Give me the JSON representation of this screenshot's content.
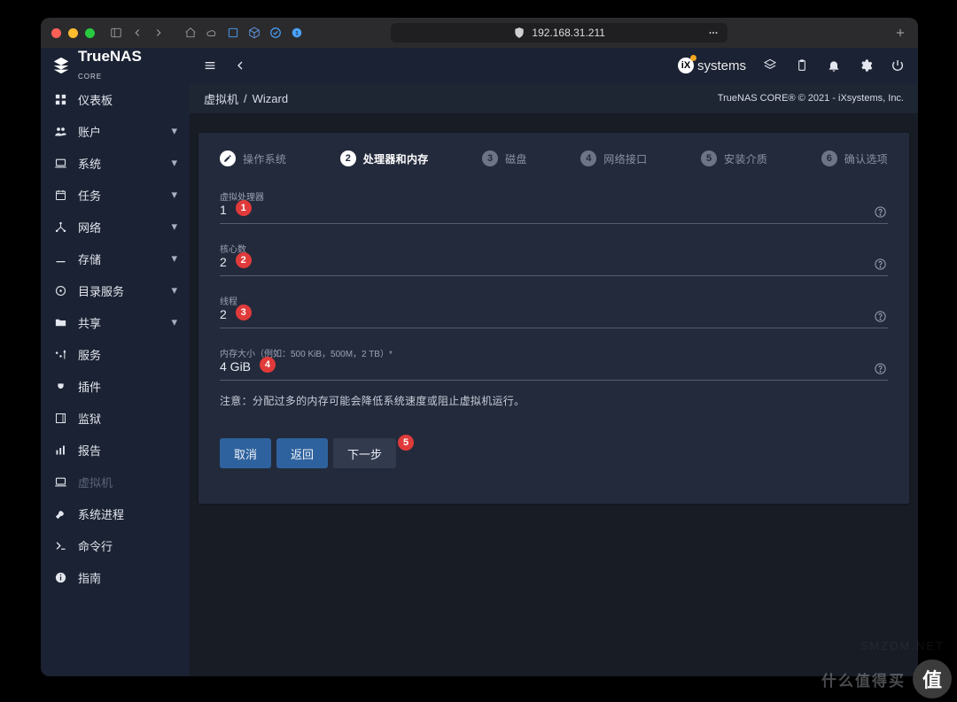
{
  "browser": {
    "url": "192.168.31.211"
  },
  "brand": {
    "name": "TrueNAS",
    "sub": "CORE"
  },
  "topbar": {
    "ixsystems": "systems"
  },
  "breadcrumb": {
    "a": "虚拟机",
    "sep": "/",
    "b": "Wizard",
    "copyright": "TrueNAS CORE® © 2021 - iXsystems, Inc."
  },
  "sidebar": [
    {
      "icon": "dashboard",
      "label": "仪表板",
      "expandable": false
    },
    {
      "icon": "people",
      "label": "账户",
      "expandable": true
    },
    {
      "icon": "laptop",
      "label": "系统",
      "expandable": true
    },
    {
      "icon": "calendar",
      "label": "任务",
      "expandable": true
    },
    {
      "icon": "network",
      "label": "网络",
      "expandable": true
    },
    {
      "icon": "list",
      "label": "存储",
      "expandable": true
    },
    {
      "icon": "disc",
      "label": "目录服务",
      "expandable": true
    },
    {
      "icon": "folder",
      "label": "共享",
      "expandable": true
    },
    {
      "icon": "sliders",
      "label": "服务",
      "expandable": false
    },
    {
      "icon": "plug",
      "label": "插件",
      "expandable": false
    },
    {
      "icon": "jail",
      "label": "监狱",
      "expandable": false
    },
    {
      "icon": "report",
      "label": "报告",
      "expandable": false
    },
    {
      "icon": "laptop",
      "label": "虚拟机",
      "expandable": false,
      "muted": true
    },
    {
      "icon": "wrench",
      "label": "系统进程",
      "expandable": false
    },
    {
      "icon": "terminal",
      "label": "命令行",
      "expandable": false
    },
    {
      "icon": "info",
      "label": "指南",
      "expandable": false
    }
  ],
  "stepper": [
    {
      "label": "操作系统",
      "state": "done"
    },
    {
      "label": "处理器和内存",
      "state": "active",
      "num": "2"
    },
    {
      "label": "磁盘",
      "state": "pending",
      "num": "3"
    },
    {
      "label": "网络接口",
      "state": "pending",
      "num": "4"
    },
    {
      "label": "安装介质",
      "state": "pending",
      "num": "5"
    },
    {
      "label": "确认选项",
      "state": "pending",
      "num": "6"
    }
  ],
  "fields": {
    "vcpu": {
      "label": "虚拟处理器",
      "value": "1",
      "annot": "1"
    },
    "cores": {
      "label": "核心数",
      "value": "2",
      "annot": "2"
    },
    "threads": {
      "label": "线程",
      "value": "2",
      "annot": "3"
    },
    "memory": {
      "label": "内存大小（例如：500 KiB，500M，2 TB）*",
      "value": "4 GiB",
      "annot": "4"
    }
  },
  "note": "注意：分配过多的内存可能会降低系统速度或阻止虚拟机运行。",
  "buttons": {
    "cancel": "取消",
    "back": "返回",
    "next": "下一步",
    "next_annot": "5"
  },
  "promo": {
    "text": "什么值得买",
    "glyph": "值"
  },
  "watermark": "SMZDM.NET"
}
